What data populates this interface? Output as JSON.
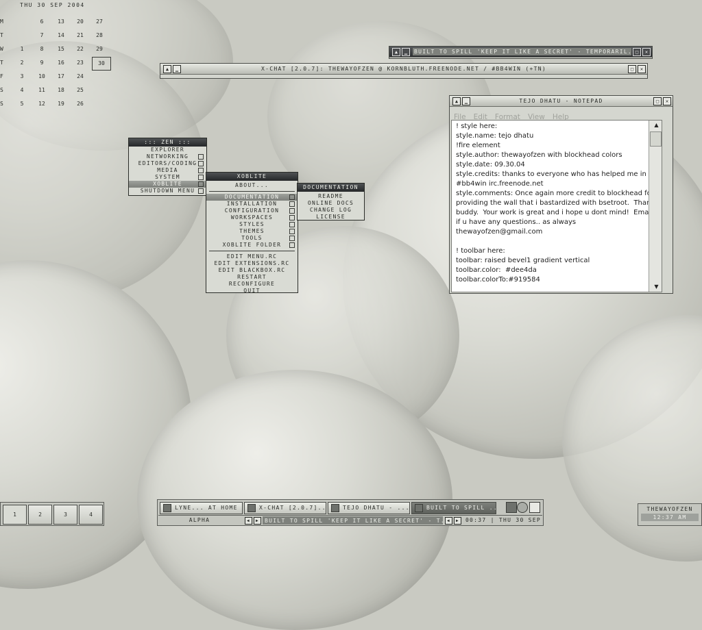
{
  "calendar": {
    "title": "THU 30 SEP 2004",
    "rows": [
      {
        "day": "M",
        "dates": [
          "",
          "6",
          "13",
          "20",
          "27"
        ]
      },
      {
        "day": "T",
        "dates": [
          "",
          "7",
          "14",
          "21",
          "28"
        ]
      },
      {
        "day": "W",
        "dates": [
          "1",
          "8",
          "15",
          "22",
          "29"
        ]
      },
      {
        "day": "T",
        "dates": [
          "2",
          "9",
          "16",
          "23",
          "30"
        ]
      },
      {
        "day": "F",
        "dates": [
          "3",
          "10",
          "17",
          "24",
          ""
        ]
      },
      {
        "day": "S",
        "dates": [
          "4",
          "11",
          "18",
          "25",
          ""
        ]
      },
      {
        "day": "S",
        "dates": [
          "5",
          "12",
          "19",
          "26",
          ""
        ]
      }
    ],
    "today": "30"
  },
  "music_window": {
    "title": "BUILT TO SPILL 'KEEP IT LIKE A SECRET' - TEMPORARIL..."
  },
  "xchat_window": {
    "title": "X-CHAT [2.0.7]: THEWAYOFZEN @ KORNBLUTH.FREENODE.NET / #BB4WIN (+TN)"
  },
  "notepad": {
    "title": "TEJO DHATU - NOTEPAD",
    "menu": [
      "File",
      "Edit",
      "Format",
      "View",
      "Help"
    ],
    "lines": [
      "! style here:",
      "style.name: tejo dhatu",
      "!fire element",
      "style.author: thewayofzen with blockhead colors",
      "style.date: 09.30.04",
      "style.credits: thanks to everyone who has helped me in",
      "#bb4win irc.freenode.net",
      "style.comments: Once again more credit to blockhead for",
      "providing the wall that i bastardized with bsetroot.  Thanks",
      "buddy.  Your work is great and i hope u dont mind!  Email me",
      "if u have any questions.. as always",
      "thewayofzen@gmail.com",
      "",
      "! toolbar here:",
      "toolbar: raised bevel1 gradient vertical",
      "toolbar.color:  #dee4da",
      "toolbar.colorTo:#919584"
    ]
  },
  "zen_menu": {
    "title": "::: ZEN :::",
    "items": [
      "EXPLORER",
      "NETWORKING",
      "EDITORS/CODING",
      "MEDIA",
      "SYSTEM",
      "XOBLITE",
      "SHUTDOWN MENU"
    ]
  },
  "xoblite_menu": {
    "title": "XOBLITE",
    "about": "ABOUT...",
    "items": [
      "DOCUMENTATION",
      "INSTALLATION",
      "CONFIGURATION",
      "WORKSPACES",
      "STYLES",
      "THEMES",
      "TOOLS",
      "XOBLITE FOLDER"
    ],
    "edit_items": [
      "EDIT MENU.RC",
      "EDIT EXTENSIONS.RC",
      "EDIT BLACKBOX.RC",
      "RESTART",
      "RECONFIGURE",
      "QUIT"
    ]
  },
  "doc_menu": {
    "title": "DOCUMENTATION",
    "items": [
      "README",
      "ONLINE DOCS",
      "CHANGE LOG",
      "LICENSE"
    ]
  },
  "taskbar": {
    "workspaces": [
      "1",
      "2",
      "3",
      "4"
    ],
    "tasks": [
      "LYNE... AT HOME",
      "X-CHAT [2.0.7]...",
      "TEJO DHATU - ...",
      "BUILT TO SPILL ..."
    ],
    "workspace_name": "ALPHA",
    "current_task": "BUILT TO SPILL 'KEEP IT LIKE A SECRET' - T...",
    "clock": "00:37 | THU 30 SEP"
  },
  "user_panel": {
    "user": "THEWAYOFZEN",
    "time": "12:37 AM"
  },
  "colors": {
    "bg": "#c9cac2",
    "dark": "#2d2f31",
    "accent": "#7e817c"
  }
}
